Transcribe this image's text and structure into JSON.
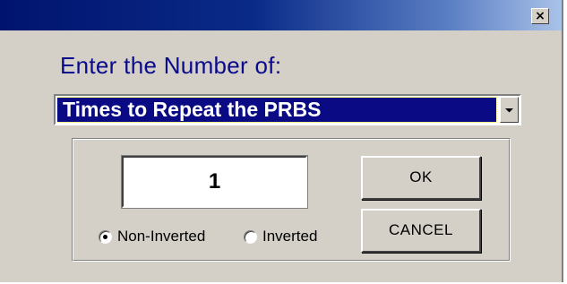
{
  "window": {
    "close_glyph": "×"
  },
  "prompt": "Enter the Number of:",
  "combo": {
    "selected": "Times to Repeat the PRBS"
  },
  "number_field": {
    "value": "1"
  },
  "buttons": {
    "ok": "OK",
    "cancel": "CANCEL"
  },
  "radios": [
    {
      "label": "Non-Inverted",
      "checked": true
    },
    {
      "label": "Inverted",
      "checked": false
    }
  ]
}
